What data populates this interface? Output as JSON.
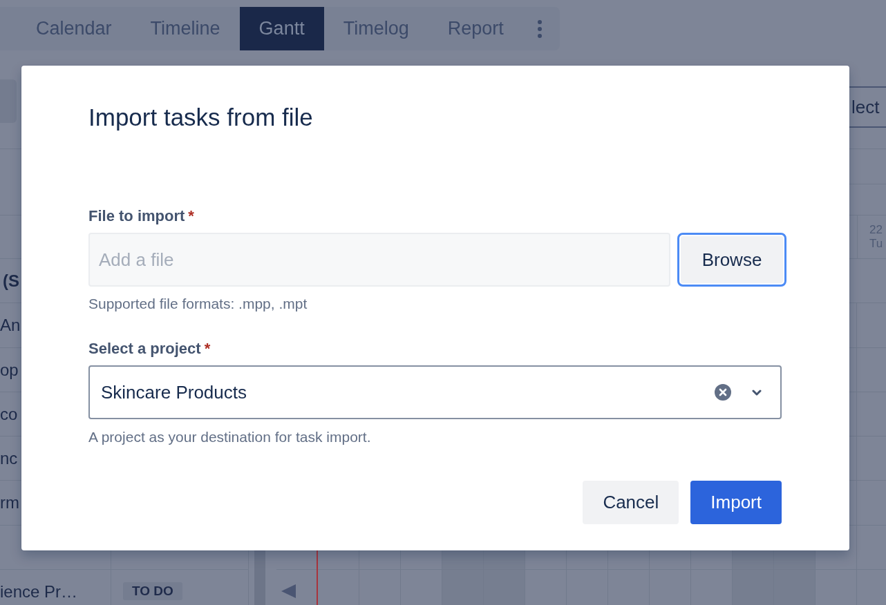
{
  "app": {
    "tabs": [
      {
        "label": "Calendar",
        "selected": false
      },
      {
        "label": "Timeline",
        "selected": false
      },
      {
        "label": "Gantt",
        "selected": true
      },
      {
        "label": "Timelog",
        "selected": false
      },
      {
        "label": "Report",
        "selected": false
      }
    ],
    "toolbar_button": "lect",
    "date_column": {
      "day": "22",
      "weekday": "Tu"
    },
    "rows": [
      {
        "kind": "group",
        "name": "(S"
      },
      {
        "kind": "task",
        "name": "An"
      },
      {
        "kind": "task",
        "name": "op"
      },
      {
        "kind": "task",
        "name": "co"
      },
      {
        "kind": "task",
        "name": "nc"
      },
      {
        "kind": "task",
        "name": "rm"
      },
      {
        "kind": "task"
      },
      {
        "kind": "task",
        "name": "ience Pr…",
        "status": "TO DO",
        "offscreen_left": true
      }
    ]
  },
  "dialog": {
    "title": "Import tasks from file",
    "file_field": {
      "label": "File to import",
      "required_mark": "*",
      "placeholder": "Add a file",
      "browse_button": {
        "label": "Browse",
        "focused": true
      },
      "help": "Supported file formats: .mpp, .mpt"
    },
    "project_field": {
      "label": "Select a project",
      "required_mark": "*",
      "value": "Skincare Products",
      "help": "A project as your destination for task import."
    },
    "buttons": [
      {
        "label": "Cancel",
        "kind": "secondary"
      },
      {
        "label": "Import",
        "kind": "primary"
      }
    ]
  }
}
